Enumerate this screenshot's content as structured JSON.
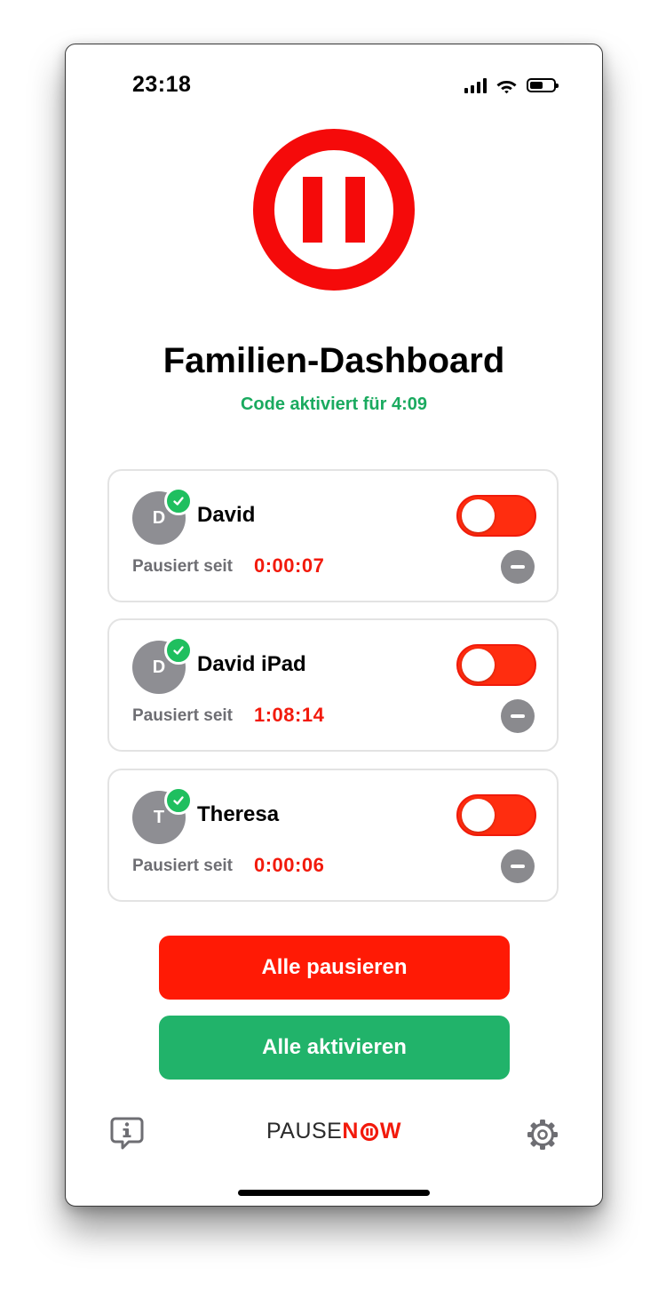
{
  "status_bar": {
    "time": "23:18"
  },
  "header": {
    "title": "Familien-Dashboard",
    "subtitle": "Code aktiviert für 4:09"
  },
  "devices": [
    {
      "initial": "D",
      "name": "David",
      "pause_label": "Pausiert seit",
      "pause_time": "0:00:07",
      "toggle_on": true
    },
    {
      "initial": "D",
      "name": "David iPad",
      "pause_label": "Pausiert seit",
      "pause_time": "1:08:14",
      "toggle_on": true
    },
    {
      "initial": "T",
      "name": "Theresa",
      "pause_label": "Pausiert seit",
      "pause_time": "0:00:06",
      "toggle_on": true
    }
  ],
  "actions": {
    "pause_all_label": "Alle pausieren",
    "activate_all_label": "Alle aktivieren"
  },
  "footer": {
    "brand_prefix": "PAUSE",
    "brand_n": "N",
    "brand_w": "W"
  },
  "colors": {
    "accent_red": "#ff1a05",
    "accent_green": "#21b36a",
    "timer_red": "#f21a0c",
    "subtitle_green": "#1aaa5f"
  },
  "icons": {
    "signal": "signal-icon",
    "wifi": "wifi-icon",
    "battery": "battery-icon",
    "logo": "pause-logo-icon",
    "check": "check-icon",
    "remove": "minus-circle-icon",
    "info": "info-bubble-icon",
    "settings": "gear-icon"
  }
}
